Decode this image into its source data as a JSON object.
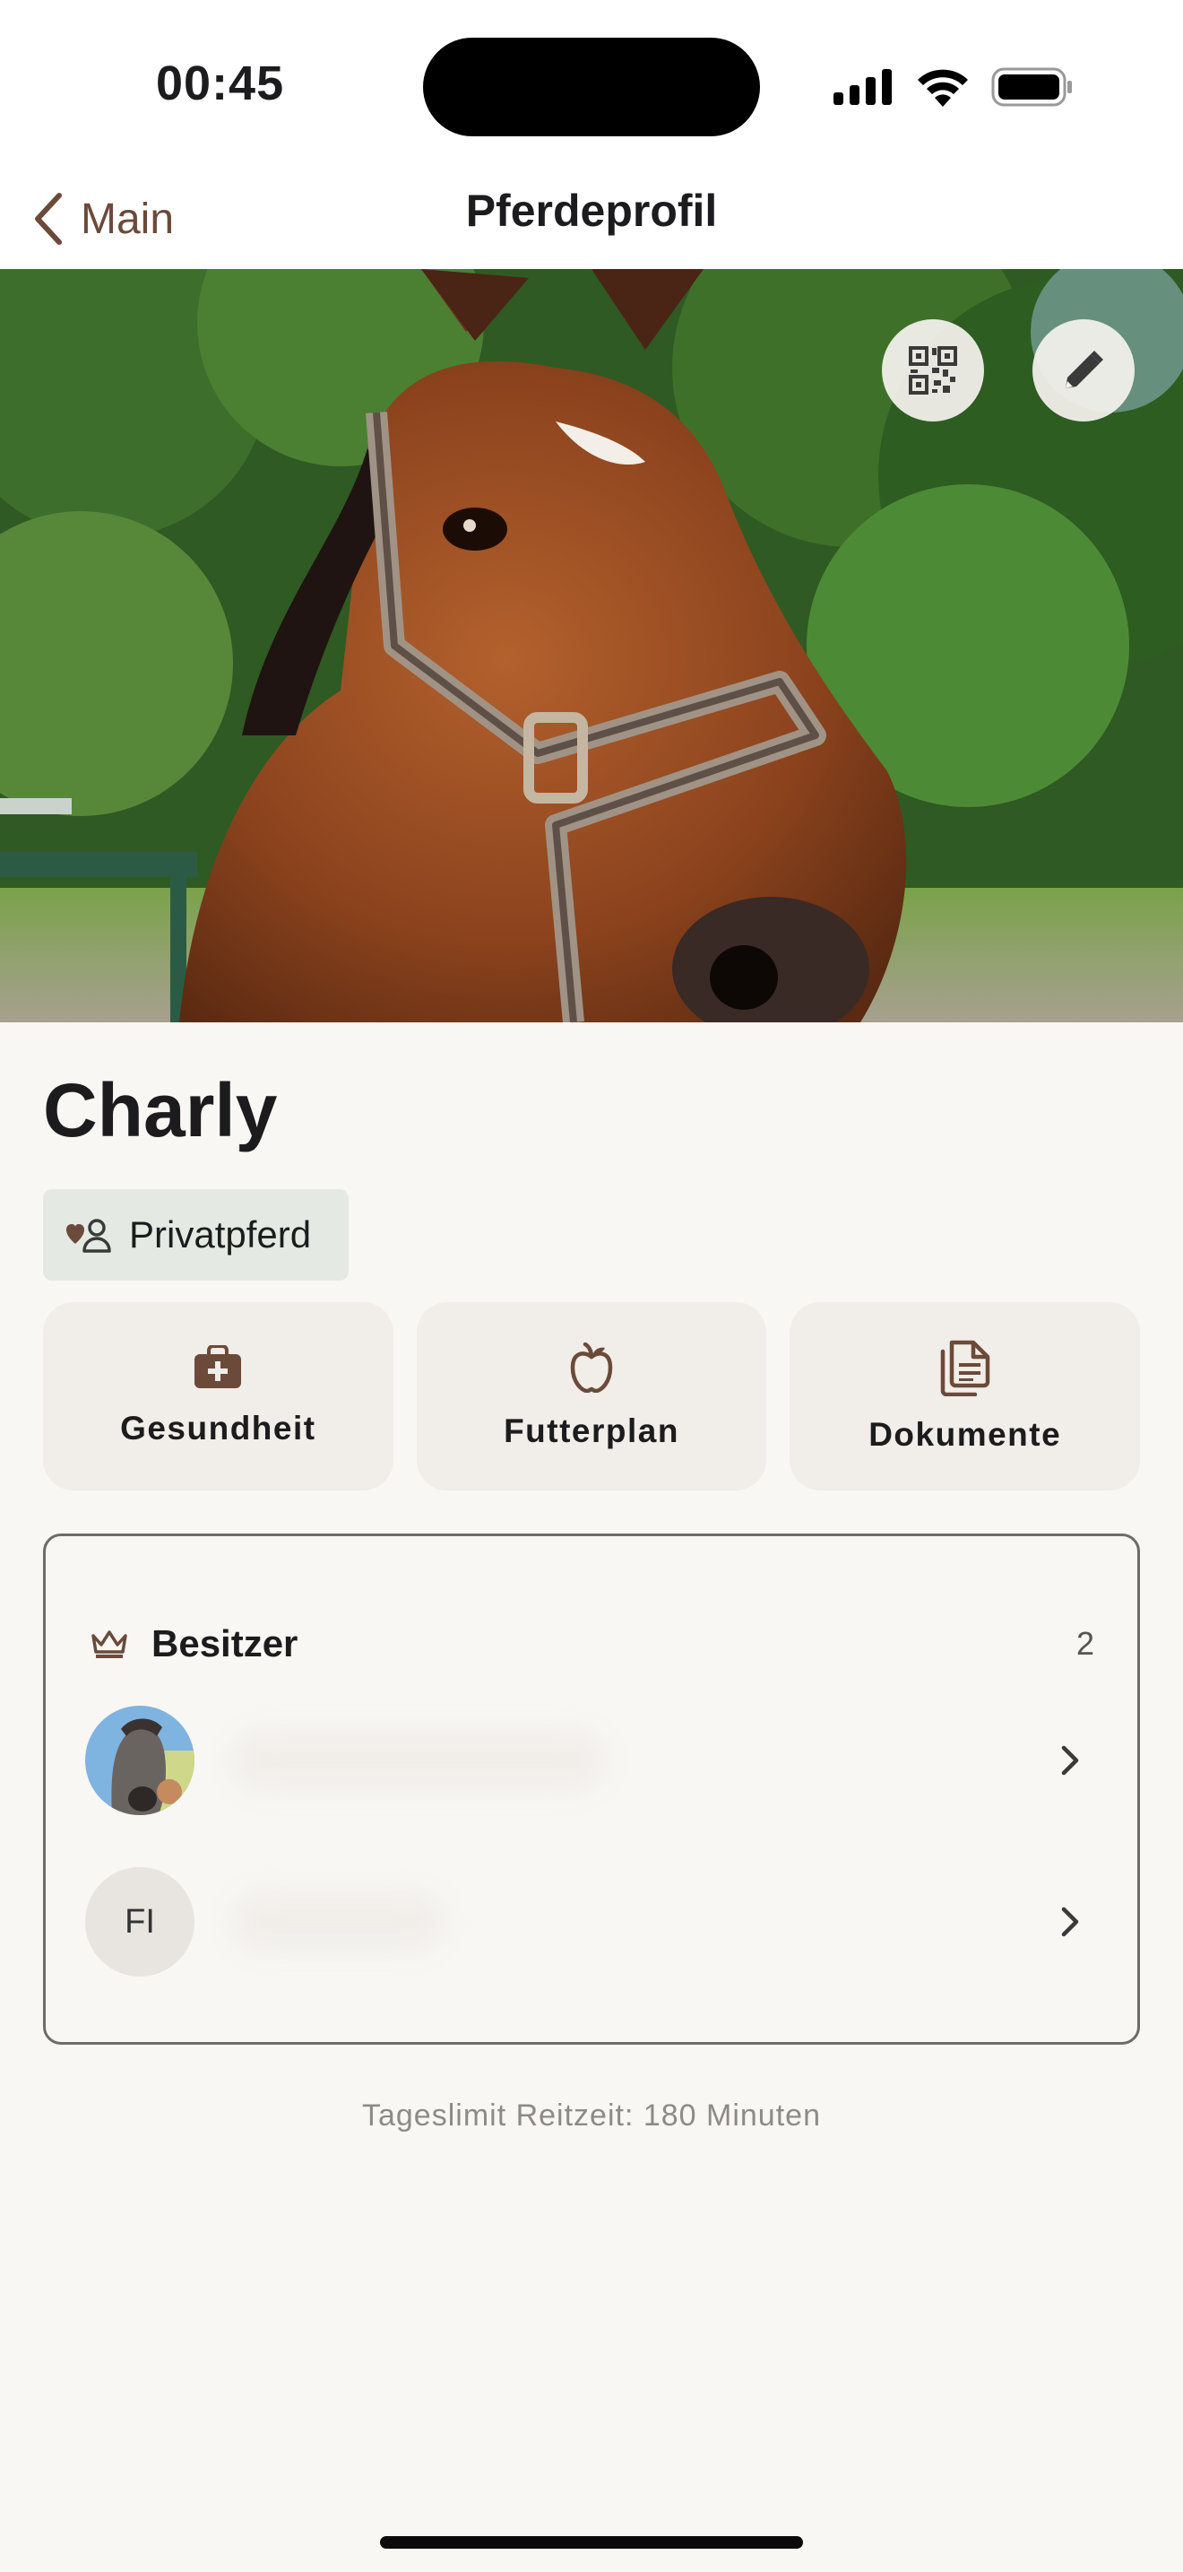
{
  "status": {
    "time": "00:45"
  },
  "nav": {
    "back_label": "Main",
    "title": "Pferdeprofil"
  },
  "hero": {
    "photo": "horse-photo",
    "qr_icon": "qr-code-icon",
    "edit_icon": "pencil-icon"
  },
  "horse": {
    "name": "Charly",
    "type": "Privatpferd"
  },
  "actions": [
    {
      "label": "Gesundheit",
      "icon": "medical-bag-icon"
    },
    {
      "label": "Futterplan",
      "icon": "apple-icon"
    },
    {
      "label": "Dokumente",
      "icon": "documents-icon"
    }
  ],
  "owners": {
    "title": "Besitzer",
    "count": "2",
    "list": [
      {
        "initials": "",
        "avatar": "photo"
      },
      {
        "initials": "FI",
        "avatar": "initials"
      }
    ]
  },
  "footer": {
    "note": "Tageslimit Reitzeit: 180 Minuten"
  },
  "colors": {
    "accent": "#6b4a3a",
    "background": "#f9f7f4",
    "badge": "#e4eae3",
    "card": "#f1ede8"
  }
}
